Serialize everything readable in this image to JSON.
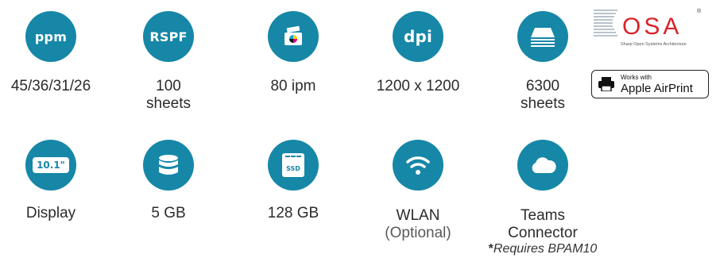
{
  "colors": {
    "circle": "#1687a7",
    "text": "#2b2b2b"
  },
  "features_row1": [
    {
      "icon": "ppm-badge-icon",
      "badge": "ppm",
      "label": "45/36/31/26"
    },
    {
      "icon": "rspf-badge-icon",
      "badge": "RSPF",
      "label_line1": "100",
      "label_line2": "sheets"
    },
    {
      "icon": "scanner-color-icon",
      "label": "80 ipm"
    },
    {
      "icon": "dpi-badge-icon",
      "badge": "dpi",
      "label": "1200 x 1200"
    },
    {
      "icon": "paper-stack-icon",
      "label_line1": "6300",
      "label_line2": "sheets"
    }
  ],
  "features_row2": [
    {
      "icon": "display-icon",
      "badge": "10.1\"",
      "label": "Display"
    },
    {
      "icon": "database-icon",
      "label": "5 GB"
    },
    {
      "icon": "ssd-icon",
      "badge": "SSD",
      "label": "128 GB"
    },
    {
      "icon": "wifi-icon",
      "label": "WLAN",
      "sub": "(Optional)"
    },
    {
      "icon": "cloud-icon",
      "label_line1": "Teams",
      "label_line2": "Connector",
      "note_star": "*",
      "note": "Requires BPAM10"
    }
  ],
  "osa_logo": {
    "mark": "OSA",
    "tagline": "Sharp Open Systems Architecture",
    "registered": "®"
  },
  "airprint_badge": {
    "small": "Works with",
    "big": "Apple AirPrint"
  }
}
